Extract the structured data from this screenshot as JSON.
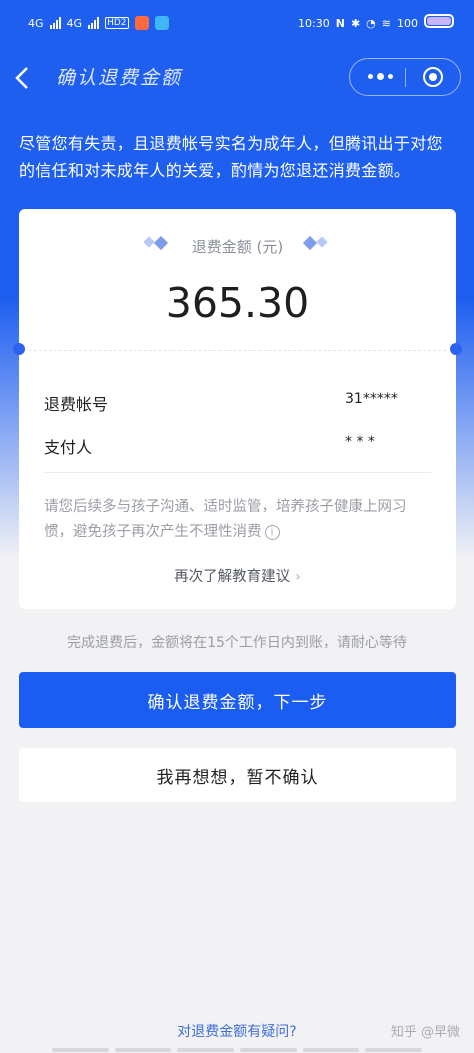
{
  "status_bar": {
    "sig1": "4G",
    "sig2": "4G",
    "hd": "HD2",
    "time": "10:30",
    "net": "N",
    "battery_text": "100"
  },
  "nav": {
    "back_icon": "chevron-left-icon",
    "title": "确认退费金额",
    "more_icon": "more-dots-icon",
    "close_icon": "target-circle-icon"
  },
  "notice": "尽管您有失责，且退费帐号实名为成年人，但腾讯出于对您的信任和对未成年人的关爱，酌情为您退还消费金额。",
  "card": {
    "amount_label": "退费金额 (元)",
    "amount": "365.30",
    "rows": [
      {
        "label": "退费帐号",
        "value": "31*****"
      },
      {
        "label": "支付人",
        "value": "*    *  *"
      }
    ],
    "tip": "请您后续多与孩子沟通、适时监管，培养孩子健康上网习惯，避免孩子再次产生不理性消费",
    "edu_link": "再次了解教育建议",
    "edu_chevron": "›"
  },
  "hint": "完成退费后，金额将在15个工作日内到账，请耐心等待",
  "buttons": {
    "confirm": "确认退费金额，下一步",
    "cancel": "我再想想，暂不确认"
  },
  "question_link": "对退费金额有疑问?",
  "watermark": "知乎 @早微",
  "colors": {
    "brand_blue": "#1a5df0",
    "link_blue": "#3f6fd8",
    "background": "#f2f2f4"
  }
}
